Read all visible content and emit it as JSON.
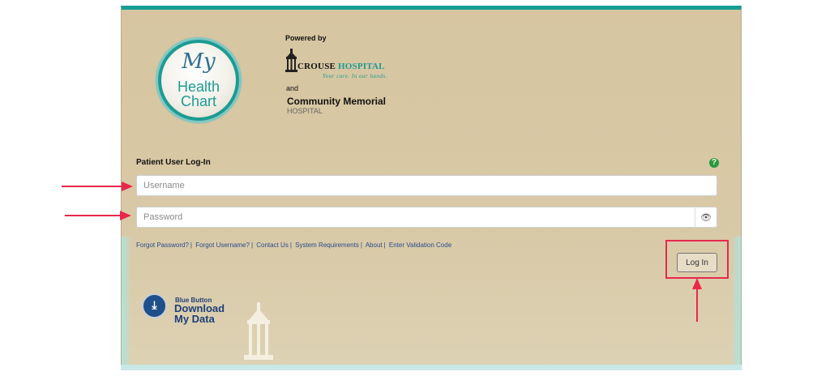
{
  "branding": {
    "logo_text": {
      "line1": "My",
      "line2": "Health",
      "line3": "Chart"
    },
    "powered_by": "Powered by",
    "crouse": {
      "name_part1": "CROUSE",
      "name_part2": "HOSPITAL",
      "tagline": "Your care. In our hands."
    },
    "and": "and",
    "community": {
      "name": "Community Memorial",
      "sub": "HOSPITAL"
    }
  },
  "form": {
    "title": "Patient User Log-In",
    "help_icon": "?",
    "username_placeholder": "Username",
    "password_placeholder": "Password",
    "eye_icon": "👁",
    "login_label": "Log In"
  },
  "links": [
    "Forgot Password?",
    "Forgot Username?",
    "Contact Us",
    "System Requirements",
    "About",
    "Enter Validation Code"
  ],
  "blue_button": {
    "line1": "Blue Button",
    "line2": "Download",
    "line3": "My Data",
    "icon": "download-icon"
  },
  "annotations": {
    "arrow_color": "#e8274b",
    "highlight_color": "#e8274b"
  },
  "colors": {
    "teal": "#159e96",
    "panel": "#d6c5a0",
    "link": "#2a4a8a"
  }
}
